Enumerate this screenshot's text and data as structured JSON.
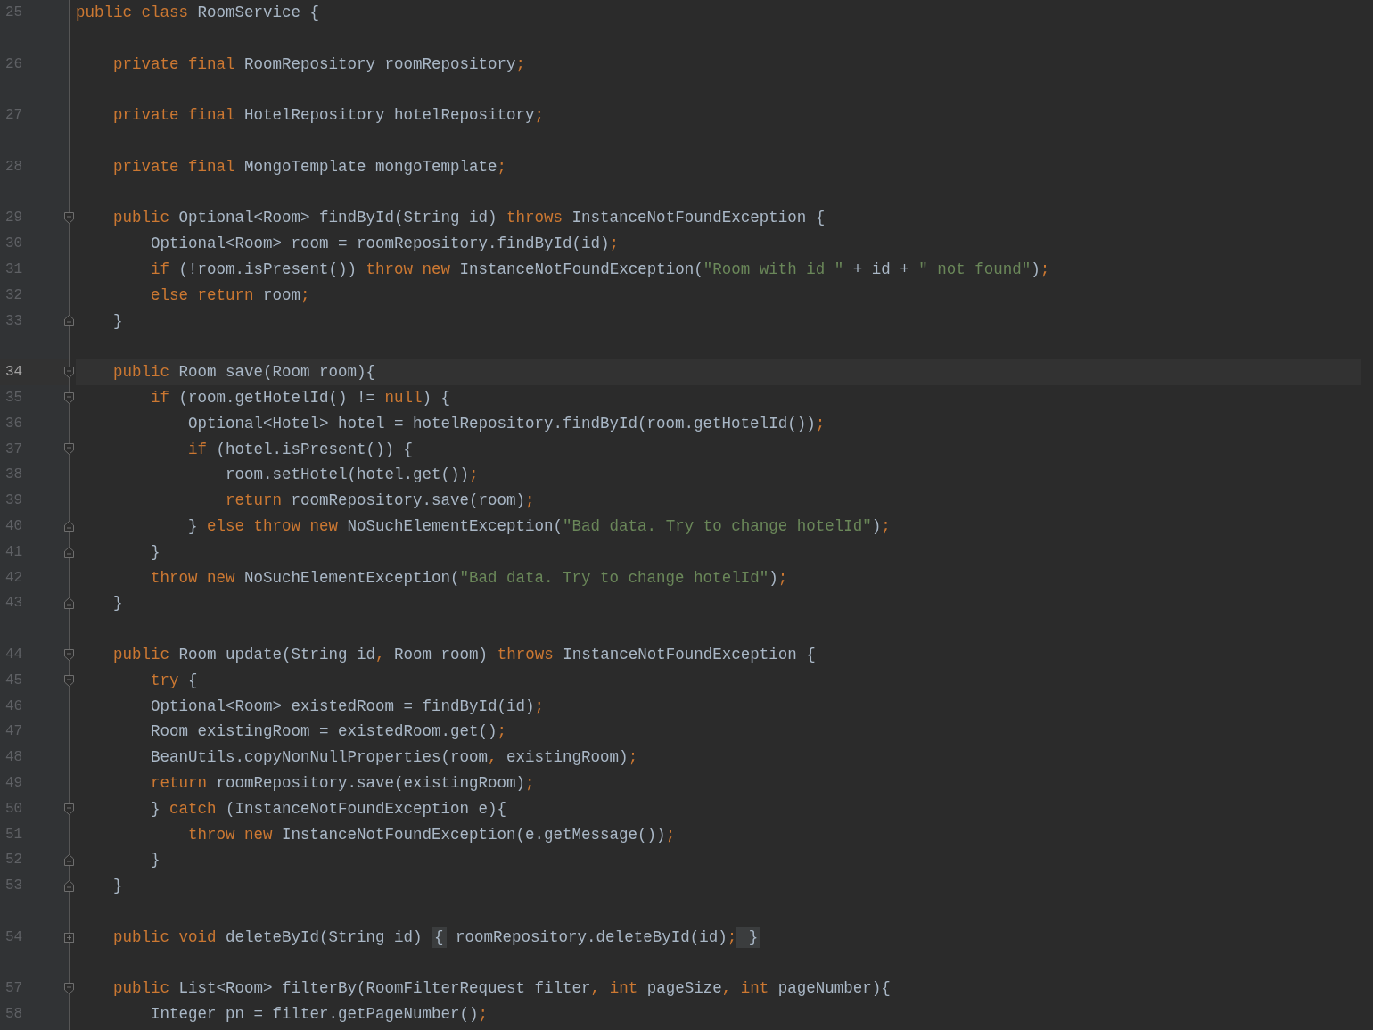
{
  "editor": {
    "lines": [
      {
        "number": "25",
        "current": false,
        "gap_before": false,
        "tokens": [
          {
            "kind": "keyword",
            "text": "public class "
          },
          {
            "kind": "plain",
            "text": "RoomService {"
          }
        ]
      },
      {
        "number": "26",
        "current": false,
        "gap_before": true,
        "tokens": [
          {
            "kind": "keyword",
            "text": "    private final "
          },
          {
            "kind": "plain",
            "text": "RoomRepository roomRepository"
          },
          {
            "kind": "punct",
            "text": ";"
          }
        ]
      },
      {
        "number": "27",
        "current": false,
        "gap_before": true,
        "tokens": [
          {
            "kind": "keyword",
            "text": "    private final "
          },
          {
            "kind": "plain",
            "text": "HotelRepository hotelRepository"
          },
          {
            "kind": "punct",
            "text": ";"
          }
        ]
      },
      {
        "number": "28",
        "current": false,
        "gap_before": true,
        "tokens": [
          {
            "kind": "keyword",
            "text": "    private final "
          },
          {
            "kind": "plain",
            "text": "MongoTemplate mongoTemplate"
          },
          {
            "kind": "punct",
            "text": ";"
          }
        ]
      },
      {
        "number": "29",
        "fold_marker": {
          "kind": "start"
        },
        "current": false,
        "gap_before": true,
        "tokens": [
          {
            "kind": "keyword",
            "text": "    public "
          },
          {
            "kind": "plain",
            "text": "Optional<Room> findById(String id) "
          },
          {
            "kind": "keyword",
            "text": "throws "
          },
          {
            "kind": "plain",
            "text": "InstanceNotFoundException {"
          }
        ]
      },
      {
        "number": "30",
        "current": false,
        "gap_before": false,
        "tokens": [
          {
            "kind": "plain",
            "text": "        Optional<Room> room = roomRepository.findById(id)"
          },
          {
            "kind": "punct",
            "text": ";"
          }
        ]
      },
      {
        "number": "31",
        "current": false,
        "gap_before": false,
        "tokens": [
          {
            "kind": "keyword",
            "text": "        if "
          },
          {
            "kind": "plain",
            "text": "(!room.isPresent()) "
          },
          {
            "kind": "keyword",
            "text": "throw new "
          },
          {
            "kind": "plain",
            "text": "InstanceNotFoundException("
          },
          {
            "kind": "string",
            "text": "\"Room with id \""
          },
          {
            "kind": "plain",
            "text": " + id + "
          },
          {
            "kind": "string",
            "text": "\" not found\""
          },
          {
            "kind": "plain",
            "text": ")"
          },
          {
            "kind": "punct",
            "text": ";"
          }
        ]
      },
      {
        "number": "32",
        "current": false,
        "gap_before": false,
        "tokens": [
          {
            "kind": "keyword",
            "text": "        else return "
          },
          {
            "kind": "plain",
            "text": "room"
          },
          {
            "kind": "punct",
            "text": ";"
          }
        ]
      },
      {
        "number": "33",
        "fold_marker": {
          "kind": "end"
        },
        "current": false,
        "gap_before": false,
        "tokens": [
          {
            "kind": "plain",
            "text": "    }"
          }
        ]
      },
      {
        "number": "34",
        "fold_marker": {
          "kind": "start"
        },
        "current": true,
        "gap_before": true,
        "tokens": [
          {
            "kind": "keyword",
            "text": "    public "
          },
          {
            "kind": "plain",
            "text": "Room save(Room room){"
          }
        ]
      },
      {
        "number": "35",
        "fold_marker": {
          "kind": "start"
        },
        "current": false,
        "gap_before": false,
        "tokens": [
          {
            "kind": "keyword",
            "text": "        if "
          },
          {
            "kind": "plain",
            "text": "(room.getHotelId() != "
          },
          {
            "kind": "keyword",
            "text": "null"
          },
          {
            "kind": "plain",
            "text": ") {"
          }
        ]
      },
      {
        "number": "36",
        "current": false,
        "gap_before": false,
        "tokens": [
          {
            "kind": "plain",
            "text": "            Optional<Hotel> hotel = hotelRepository.findById(room.getHotelId())"
          },
          {
            "kind": "punct",
            "text": ";"
          }
        ]
      },
      {
        "number": "37",
        "fold_marker": {
          "kind": "start"
        },
        "current": false,
        "gap_before": false,
        "tokens": [
          {
            "kind": "keyword",
            "text": "            if "
          },
          {
            "kind": "plain",
            "text": "(hotel.isPresent()) {"
          }
        ]
      },
      {
        "number": "38",
        "current": false,
        "gap_before": false,
        "tokens": [
          {
            "kind": "plain",
            "text": "                room.setHotel(hotel.get())"
          },
          {
            "kind": "punct",
            "text": ";"
          }
        ]
      },
      {
        "number": "39",
        "current": false,
        "gap_before": false,
        "tokens": [
          {
            "kind": "keyword",
            "text": "                return "
          },
          {
            "kind": "plain",
            "text": "roomRepository.save(room)"
          },
          {
            "kind": "punct",
            "text": ";"
          }
        ]
      },
      {
        "number": "40",
        "fold_marker": {
          "kind": "end"
        },
        "current": false,
        "gap_before": false,
        "tokens": [
          {
            "kind": "plain",
            "text": "            } "
          },
          {
            "kind": "keyword",
            "text": "else throw new "
          },
          {
            "kind": "plain",
            "text": "NoSuchElementException("
          },
          {
            "kind": "string",
            "text": "\"Bad data. Try to change hotelId\""
          },
          {
            "kind": "plain",
            "text": ")"
          },
          {
            "kind": "punct",
            "text": ";"
          }
        ]
      },
      {
        "number": "41",
        "fold_marker": {
          "kind": "end"
        },
        "current": false,
        "gap_before": false,
        "tokens": [
          {
            "kind": "plain",
            "text": "        }"
          }
        ]
      },
      {
        "number": "42",
        "current": false,
        "gap_before": false,
        "tokens": [
          {
            "kind": "keyword",
            "text": "        throw new "
          },
          {
            "kind": "plain",
            "text": "NoSuchElementException("
          },
          {
            "kind": "string",
            "text": "\"Bad data. Try to change hotelId\""
          },
          {
            "kind": "plain",
            "text": ")"
          },
          {
            "kind": "punct",
            "text": ";"
          }
        ]
      },
      {
        "number": "43",
        "fold_marker": {
          "kind": "end"
        },
        "current": false,
        "gap_before": false,
        "tokens": [
          {
            "kind": "plain",
            "text": "    }"
          }
        ]
      },
      {
        "number": "44",
        "fold_marker": {
          "kind": "start"
        },
        "current": false,
        "gap_before": true,
        "tokens": [
          {
            "kind": "keyword",
            "text": "    public "
          },
          {
            "kind": "plain",
            "text": "Room update(String id"
          },
          {
            "kind": "punct",
            "text": ","
          },
          {
            "kind": "plain",
            "text": " Room room) "
          },
          {
            "kind": "keyword",
            "text": "throws "
          },
          {
            "kind": "plain",
            "text": "InstanceNotFoundException {"
          }
        ]
      },
      {
        "number": "45",
        "fold_marker": {
          "kind": "start"
        },
        "current": false,
        "gap_before": false,
        "tokens": [
          {
            "kind": "keyword",
            "text": "        try "
          },
          {
            "kind": "plain",
            "text": "{"
          }
        ]
      },
      {
        "number": "46",
        "current": false,
        "gap_before": false,
        "tokens": [
          {
            "kind": "plain",
            "text": "        Optional<Room> existedRoom = findById(id)"
          },
          {
            "kind": "punct",
            "text": ";"
          }
        ]
      },
      {
        "number": "47",
        "current": false,
        "gap_before": false,
        "tokens": [
          {
            "kind": "plain",
            "text": "        Room existingRoom = existedRoom.get()"
          },
          {
            "kind": "punct",
            "text": ";"
          }
        ]
      },
      {
        "number": "48",
        "current": false,
        "gap_before": false,
        "tokens": [
          {
            "kind": "plain",
            "text": "        BeanUtils.copyNonNullProperties(room"
          },
          {
            "kind": "punct",
            "text": ","
          },
          {
            "kind": "plain",
            "text": " existingRoom)"
          },
          {
            "kind": "punct",
            "text": ";"
          }
        ]
      },
      {
        "number": "49",
        "current": false,
        "gap_before": false,
        "tokens": [
          {
            "kind": "keyword",
            "text": "        return "
          },
          {
            "kind": "plain",
            "text": "roomRepository.save(existingRoom)"
          },
          {
            "kind": "punct",
            "text": ";"
          }
        ]
      },
      {
        "number": "50",
        "fold_marker": {
          "kind": "start"
        },
        "current": false,
        "gap_before": false,
        "tokens": [
          {
            "kind": "plain",
            "text": "        } "
          },
          {
            "kind": "keyword",
            "text": "catch "
          },
          {
            "kind": "plain",
            "text": "(InstanceNotFoundException e){"
          }
        ]
      },
      {
        "number": "51",
        "current": false,
        "gap_before": false,
        "tokens": [
          {
            "kind": "keyword",
            "text": "            throw new "
          },
          {
            "kind": "plain",
            "text": "InstanceNotFoundException(e.getMessage())"
          },
          {
            "kind": "punct",
            "text": ";"
          }
        ]
      },
      {
        "number": "52",
        "fold_marker": {
          "kind": "end"
        },
        "current": false,
        "gap_before": false,
        "tokens": [
          {
            "kind": "plain",
            "text": "        }"
          }
        ]
      },
      {
        "number": "53",
        "fold_marker": {
          "kind": "end"
        },
        "current": false,
        "gap_before": false,
        "tokens": [
          {
            "kind": "plain",
            "text": "    }"
          }
        ]
      },
      {
        "number": "54",
        "fold_marker": {
          "kind": "collapsed"
        },
        "current": false,
        "gap_before": true,
        "tokens": [
          {
            "kind": "keyword",
            "text": "    public void "
          },
          {
            "kind": "plain",
            "text": "deleteById(String id) "
          },
          {
            "kind": "folded",
            "text": "{"
          },
          {
            "kind": "plain",
            "text": " roomRepository.deleteById(id)"
          },
          {
            "kind": "punct",
            "text": ";"
          },
          {
            "kind": "folded",
            "text": " }"
          }
        ]
      },
      {
        "number": "57",
        "fold_marker": {
          "kind": "start"
        },
        "current": false,
        "gap_before": true,
        "tokens": [
          {
            "kind": "keyword",
            "text": "    public "
          },
          {
            "kind": "plain",
            "text": "List<Room> filterBy(RoomFilterRequest filter"
          },
          {
            "kind": "punct",
            "text": ","
          },
          {
            "kind": "keyword",
            "text": " int "
          },
          {
            "kind": "plain",
            "text": "pageSize"
          },
          {
            "kind": "punct",
            "text": ","
          },
          {
            "kind": "keyword",
            "text": " int "
          },
          {
            "kind": "plain",
            "text": "pageNumber){"
          }
        ]
      },
      {
        "number": "58",
        "current": false,
        "gap_before": false,
        "tokens": [
          {
            "kind": "plain",
            "text": "        Integer pn = filter.getPageNumber()"
          },
          {
            "kind": "punct",
            "text": ";"
          }
        ]
      }
    ]
  }
}
